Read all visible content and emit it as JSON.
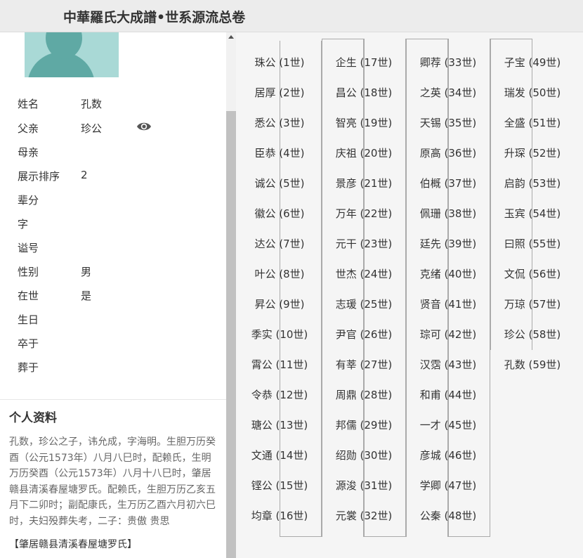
{
  "header": {
    "title": "中華羅氏大成譜•世系源流总卷"
  },
  "person": {
    "fields": [
      {
        "label": "姓名",
        "value": "孔数"
      },
      {
        "label": "父亲",
        "value": "珍公"
      },
      {
        "label": "母亲",
        "value": ""
      },
      {
        "label": "展示排序",
        "value": "2"
      },
      {
        "label": "辈分",
        "value": ""
      },
      {
        "label": "字",
        "value": ""
      },
      {
        "label": "谥号",
        "value": ""
      },
      {
        "label": "性别",
        "value": "男"
      },
      {
        "label": "在世",
        "value": "是"
      },
      {
        "label": "生日",
        "value": ""
      },
      {
        "label": "卒于",
        "value": ""
      },
      {
        "label": "葬于",
        "value": ""
      }
    ],
    "father_view_icon": "eye-icon"
  },
  "profile": {
    "title": "个人资料",
    "text": "孔数，珍公之子，讳允成，字海明。生胆万历癸酉（公元1573年）八月八巳时，配赖氏，生明万历癸酉（公元1573年）八月十八巳时，肇居赣县清溪春屋塘罗氏。配赖氏，生胆万历乙亥五月下二卯时；副配康氏，生万历乙酉六月初六巳时，夫妇殁葬失考，二子：贵傲 贵思",
    "source": "【肇居赣县清溪春屋塘罗氏】"
  },
  "lineage": [
    [
      "珠公 (1世)",
      "居厚 (2世)",
      "悉公 (3世)",
      "臣恭 (4世)",
      "诚公 (5世)",
      "徽公 (6世)",
      "达公 (7世)",
      "叶公 (8世)",
      "昇公 (9世)",
      "季实 (10世)",
      "霄公 (11世)",
      "令恭 (12世)",
      "瑭公 (13世)",
      "文通 (14世)",
      "铿公 (15世)",
      "均章 (16世)"
    ],
    [
      "企生 (17世)",
      "昌公 (18世)",
      "智亮 (19世)",
      "庆祖 (20世)",
      "景彦 (21世)",
      "万年 (22世)",
      "元干 (23世)",
      "世杰 (24世)",
      "志瑗 (25世)",
      "尹官 (26世)",
      "有莘 (27世)",
      "周鼎 (28世)",
      "邦儒 (29世)",
      "绍勋 (30世)",
      "源浚 (31世)",
      "元裳 (32世)"
    ],
    [
      "卿荐 (33世)",
      "之英 (34世)",
      "天锡 (35世)",
      "原高 (36世)",
      "伯概 (37世)",
      "佩珊 (38世)",
      "廷先 (39世)",
      "克绪 (40世)",
      "贤音 (41世)",
      "琮可 (42世)",
      "汉霑 (43世)",
      "和甫 (44世)",
      "一才 (45世)",
      "彦城 (46世)",
      "学卿 (47世)",
      "公秦 (48世)"
    ],
    [
      "子宝 (49世)",
      "瑞发 (50世)",
      "全盛 (51世)",
      "升琛 (52世)",
      "启韵 (53世)",
      "玉宾 (54世)",
      "曰照 (55世)",
      "文侃 (56世)",
      "万琼 (57世)",
      "珍公 (58世)",
      "孔数 (59世)"
    ]
  ]
}
